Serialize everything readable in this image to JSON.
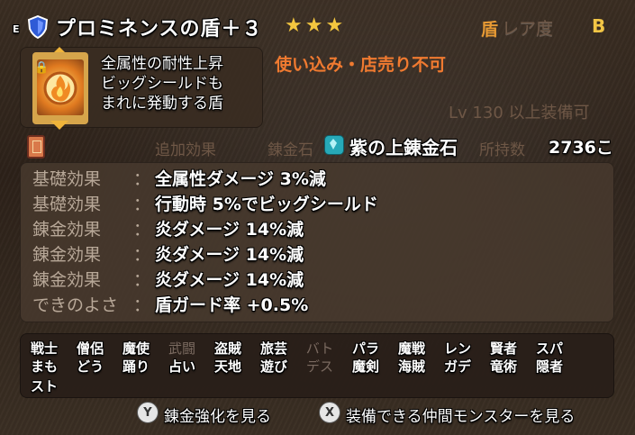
{
  "header": {
    "equip_mark": "E",
    "item_name": "プロミネンスの盾＋３",
    "stars": "★★★",
    "rarity_icon": "盾",
    "rarity_label": "レア度",
    "rarity_value": "B"
  },
  "item": {
    "description": [
      "全属性の耐性上昇",
      "ビッグシールドも",
      "まれに発動する盾"
    ],
    "warning": "使い込み・店売り不可",
    "level_prefix": "Lv",
    "level_number": "130",
    "level_suffix": "以上装備可"
  },
  "alchemy": {
    "additional_label": "追加効果",
    "stone_label": "錬金石",
    "stone_name": "紫の上錬金石",
    "owned_label": "所持数",
    "owned_count": "2736こ"
  },
  "effects": [
    {
      "category": "基礎効果",
      "value": "全属性ダメージ 3%減"
    },
    {
      "category": "基礎効果",
      "value": "行動時 5%でビッグシールド"
    },
    {
      "category": "錬金効果",
      "value": "炎ダメージ 14%減"
    },
    {
      "category": "錬金効果",
      "value": "炎ダメージ 14%減"
    },
    {
      "category": "錬金効果",
      "value": "炎ダメージ 14%減"
    },
    {
      "category": "できのよさ",
      "value": "盾ガード率 +0.5%"
    }
  ],
  "effect_colon": "：",
  "jobs": [
    {
      "label": "戦士",
      "enabled": true
    },
    {
      "label": "僧侶",
      "enabled": true
    },
    {
      "label": "魔使",
      "enabled": true
    },
    {
      "label": "武闘",
      "enabled": false
    },
    {
      "label": "盗賊",
      "enabled": true
    },
    {
      "label": "旅芸",
      "enabled": true
    },
    {
      "label": "バト",
      "enabled": false
    },
    {
      "label": "パラ",
      "enabled": true
    },
    {
      "label": "魔戦",
      "enabled": true
    },
    {
      "label": "レン",
      "enabled": true
    },
    {
      "label": "賢者",
      "enabled": true
    },
    {
      "label": "スパ",
      "enabled": true
    },
    {
      "label": "まも",
      "enabled": true
    },
    {
      "label": "どう",
      "enabled": true
    },
    {
      "label": "踊り",
      "enabled": true
    },
    {
      "label": "占い",
      "enabled": true
    },
    {
      "label": "天地",
      "enabled": true
    },
    {
      "label": "遊び",
      "enabled": true
    },
    {
      "label": "デス",
      "enabled": false
    },
    {
      "label": "魔剣",
      "enabled": true
    },
    {
      "label": "海賊",
      "enabled": true
    },
    {
      "label": "ガデ",
      "enabled": true
    },
    {
      "label": "竜術",
      "enabled": true
    },
    {
      "label": "隠者",
      "enabled": true
    },
    {
      "label": "スト",
      "enabled": true
    }
  ],
  "footer": {
    "left_button": "Y",
    "left_label": "錬金強化を見る",
    "right_button": "X",
    "right_label": "装備できる仲間モンスターを見る"
  },
  "icons": {
    "equip": "shield-icon",
    "item": "fire-shield-icon",
    "lock": "lock-icon",
    "book": "book-icon",
    "stone": "alchemy-stone-icon"
  },
  "colors": {
    "warning": "#f07a30",
    "rarity": "#f2c545",
    "stars": "#f3c63f"
  }
}
